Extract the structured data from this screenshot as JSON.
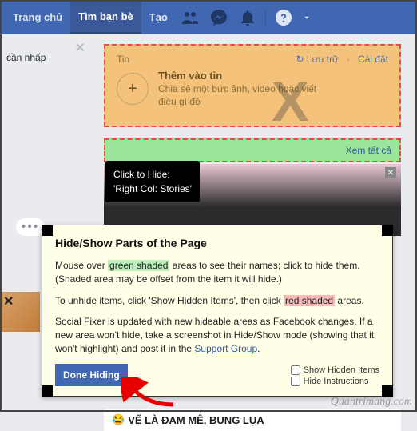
{
  "topbar": {
    "home": "Trang chủ",
    "find_friends": "Tìm bạn bè",
    "create": "Tạo"
  },
  "leftcol": {
    "shortcuts_label": "cần nhấp"
  },
  "stories": {
    "header": "Tin",
    "archive": "Lưu trữ",
    "settings": "Cài đặt",
    "add_title": "Thêm vào tin",
    "add_sub": "Chia sẻ một bức ảnh, video hoặc viết điều gì đó"
  },
  "see_all": "Xem tất cả",
  "tooltip": {
    "line1": "Click to Hide:",
    "line2": "'Right Col: Stories'"
  },
  "panel": {
    "title": "Hide/Show Parts of the Page",
    "p1a": "Mouse over ",
    "p1_green": "green shaded",
    "p1b": " areas to see their names; click to hide them. (Shaded area may be offset from the item it will hide.)",
    "p2a": "To unhide items, click 'Show Hidden Items', then click ",
    "p2_red": "red shaded",
    "p2b": " areas.",
    "p3a": "Social Fixer is updated with new hideable areas as Facebook changes. If a new area won't hide, take a screenshot in Hide/Show mode (showing that it won't highlight) and post it in the ",
    "p3_link": "Support Group",
    "p3b": ".",
    "button": "Done Hiding",
    "cb1": "Show Hidden Items",
    "cb2": "Hide Instructions"
  },
  "bottom_post": "VẼ LÀ ĐAM MÊ, BUNG LỤA",
  "watermark": "Quantrimang.com"
}
